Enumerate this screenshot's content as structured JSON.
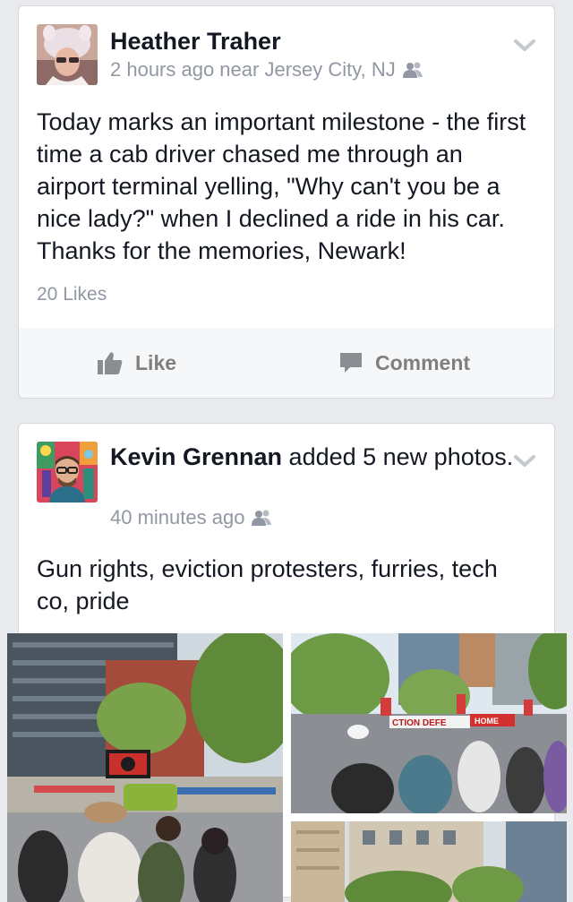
{
  "posts": [
    {
      "author": "Heather Traher",
      "time": "2 hours ago near Jersey City, NJ",
      "privacy_icon": "friends-icon",
      "text": "Today marks an important milestone - the first time a cab driver chased me through an airport terminal yelling, \"Why can't you be a nice lady?\" when I declined a ride in his car. Thanks for the memories, Newark!",
      "likes": "20 Likes",
      "like_label": "Like",
      "comment_label": "Comment"
    },
    {
      "author": "Kevin Grennan",
      "action": " added 5 new photos.",
      "time": "40 minutes ago",
      "privacy_icon": "friends-icon",
      "text": "Gun rights, eviction protesters, furries, tech co, pride",
      "sign_text": "CTION DEFE",
      "sign_text_2": "HOME"
    }
  ],
  "colors": {
    "text": "#141823",
    "meta": "#9197a3",
    "background": "#e9eaee",
    "action": "#7f7f7f"
  }
}
